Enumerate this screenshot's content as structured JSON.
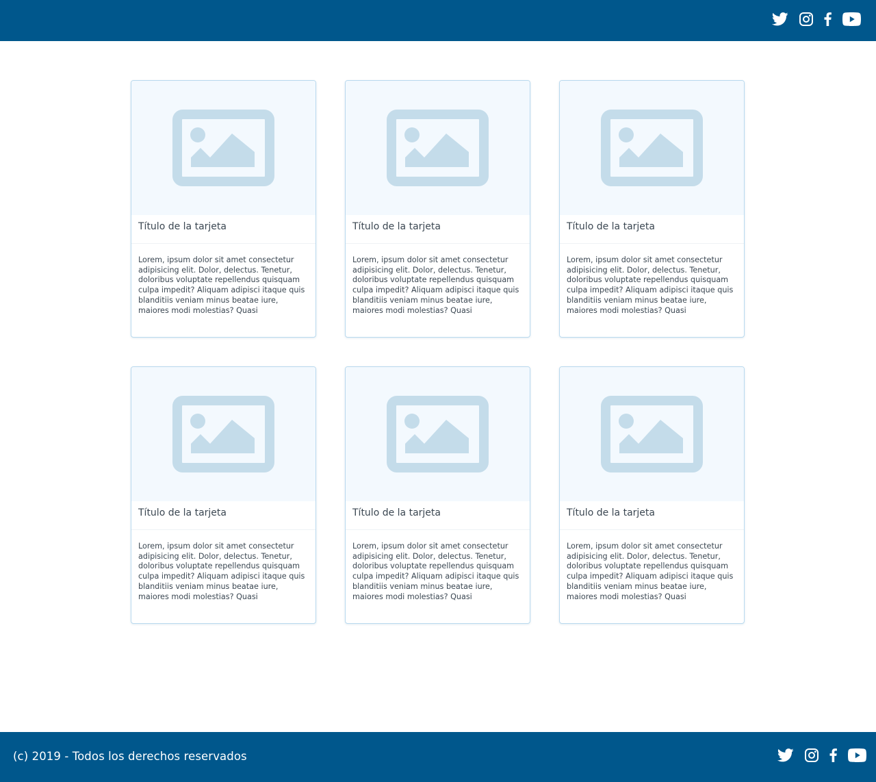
{
  "header": {
    "social": [
      {
        "icon": "twitter-icon"
      },
      {
        "icon": "instagram-icon"
      },
      {
        "icon": "facebook-icon"
      },
      {
        "icon": "youtube-icon"
      }
    ]
  },
  "cards": [
    {
      "image_icon": "image-placeholder-icon",
      "title": "Título de la tarjeta",
      "body": "Lorem, ipsum dolor sit amet consectetur adipisicing elit. Dolor, delectus. Tenetur, doloribus voluptate repellendus quisquam culpa impedit? Aliquam adipisci itaque quis blanditiis veniam minus beatae iure, maiores modi molestias? Quasi"
    },
    {
      "image_icon": "image-placeholder-icon",
      "title": "Título de la tarjeta",
      "body": "Lorem, ipsum dolor sit amet consectetur adipisicing elit. Dolor, delectus. Tenetur, doloribus voluptate repellendus quisquam culpa impedit? Aliquam adipisci itaque quis blanditiis veniam minus beatae iure, maiores modi molestias? Quasi"
    },
    {
      "image_icon": "image-placeholder-icon",
      "title": "Título de la tarjeta",
      "body": "Lorem, ipsum dolor sit amet consectetur adipisicing elit. Dolor, delectus. Tenetur, doloribus voluptate repellendus quisquam culpa impedit? Aliquam adipisci itaque quis blanditiis veniam minus beatae iure, maiores modi molestias? Quasi"
    },
    {
      "image_icon": "image-placeholder-icon",
      "title": "Título de la tarjeta",
      "body": "Lorem, ipsum dolor sit amet consectetur adipisicing elit. Dolor, delectus. Tenetur, doloribus voluptate repellendus quisquam culpa impedit? Aliquam adipisci itaque quis blanditiis veniam minus beatae iure, maiores modi molestias? Quasi"
    },
    {
      "image_icon": "image-placeholder-icon",
      "title": "Título de la tarjeta",
      "body": "Lorem, ipsum dolor sit amet consectetur adipisicing elit. Dolor, delectus. Tenetur, doloribus voluptate repellendus quisquam culpa impedit? Aliquam adipisci itaque quis blanditiis veniam minus beatae iure, maiores modi molestias? Quasi"
    },
    {
      "image_icon": "image-placeholder-icon",
      "title": "Título de la tarjeta",
      "body": "Lorem, ipsum dolor sit amet consectetur adipisicing elit. Dolor, delectus. Tenetur, doloribus voluptate repellendus quisquam culpa impedit? Aliquam adipisci itaque quis blanditiis veniam minus beatae iure, maiores modi molestias? Quasi"
    }
  ],
  "footer": {
    "copyright": "(c) 2019 - Todos los derechos reservados",
    "social": [
      {
        "icon": "twitter-icon"
      },
      {
        "icon": "instagram-icon"
      },
      {
        "icon": "facebook-icon"
      },
      {
        "icon": "youtube-icon"
      }
    ]
  },
  "colors": {
    "brand_blue": "#00578c",
    "card_border": "#b9d9ee",
    "image_background": "#f3f9fe",
    "image_icon": "#c4dcea",
    "text": "#3b4752"
  }
}
